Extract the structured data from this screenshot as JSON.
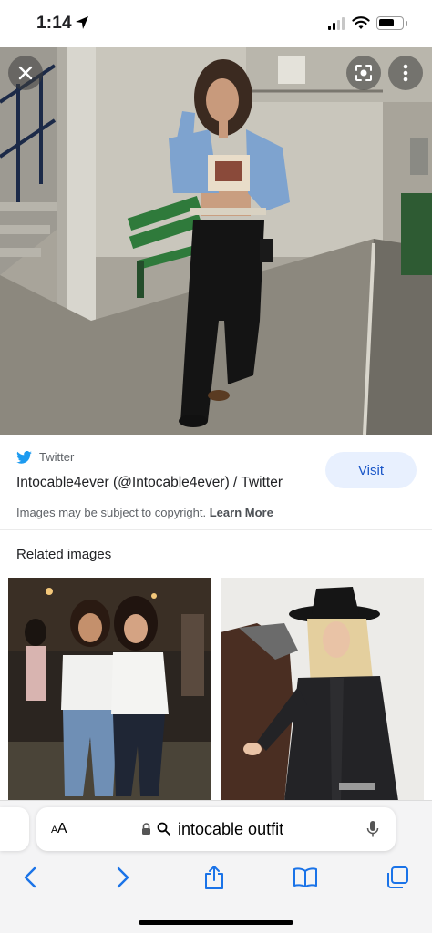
{
  "status_bar": {
    "time": "1:14",
    "location_icon": "location-arrow-icon",
    "signal_icon": "cellular-signal-icon",
    "wifi_icon": "wifi-icon",
    "battery_icon": "battery-icon"
  },
  "viewer": {
    "close_icon": "close-icon",
    "lens_icon": "google-lens-icon",
    "more_icon": "more-vertical-icon"
  },
  "result": {
    "source_icon": "twitter-bird-icon",
    "source": "Twitter",
    "title": "Intocable4ever (@Intocable4ever) / Twitter",
    "visit_label": "Visit",
    "copyright_text": "Images may be subject to copyright.",
    "learn_more": "Learn More"
  },
  "related": {
    "heading": "Related images"
  },
  "browser": {
    "aa_small": "A",
    "aa_large": "A",
    "query": "intocable outfit",
    "nav": [
      "back-chevron-icon",
      "forward-chevron-icon",
      "share-icon",
      "bookmarks-book-icon",
      "tabs-icon"
    ]
  },
  "colors": {
    "accent": "#1a73e8",
    "twitter": "#1d9bf0",
    "visit_bg": "#e8f0fe",
    "toolbar_bg": "#f4f4f5"
  }
}
